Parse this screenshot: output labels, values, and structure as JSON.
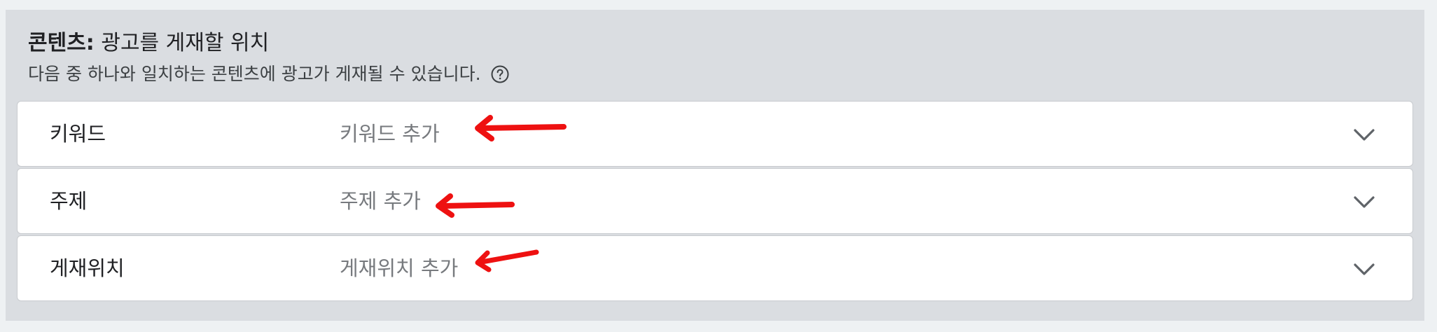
{
  "section": {
    "title_bold": "콘텐츠:",
    "title_rest": " 광고를 게재할 위치",
    "subtitle": "다음 중 하나와 일치하는 콘텐츠에 광고가 게재될 수 있습니다.",
    "help_icon": "question-circle-icon"
  },
  "rows": [
    {
      "label": "키워드",
      "placeholder": "키워드 추가",
      "icon": "chevron-down-icon"
    },
    {
      "label": "주제",
      "placeholder": "주제 추가",
      "icon": "chevron-down-icon"
    },
    {
      "label": "게재위치",
      "placeholder": "게재위치 추가",
      "icon": "chevron-down-icon"
    }
  ],
  "annotation_color": "#ee1111"
}
